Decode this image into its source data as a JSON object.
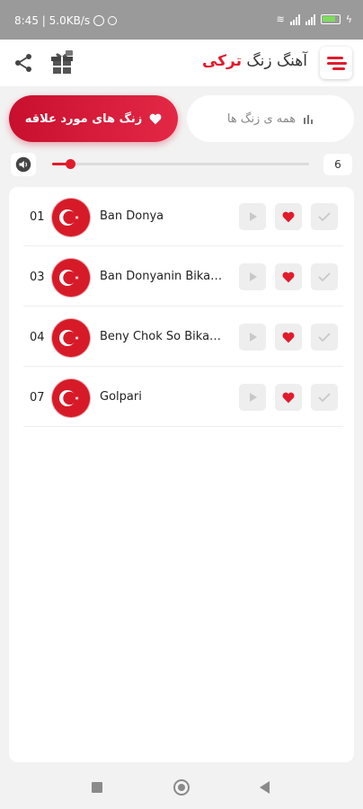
{
  "status_bar": {
    "time_speed": "8:45 | 5.0KB/s",
    "battery": "95"
  },
  "app_bar": {
    "title_prefix": "آهنگ زنگ",
    "title_accent": "ترکی",
    "icons": [
      "share-icon",
      "gift-icon",
      "menu-icon"
    ]
  },
  "tabs": {
    "favorites_label": "زنگ های مورد علاقه",
    "all_label": "همه ی زنگ ها"
  },
  "volume": {
    "value": "6",
    "level": 0.07
  },
  "songs": [
    {
      "num": "01",
      "name": "Ban Donya"
    },
    {
      "num": "03",
      "name": "Ban Donyanin Bikadar"
    },
    {
      "num": "04",
      "name": "Beny Chok So Bikadar"
    },
    {
      "num": "07",
      "name": "Golpari"
    }
  ],
  "colors": {
    "accent": "#e11b2c",
    "background": "#f2f2f2",
    "card": "#ffffff"
  }
}
